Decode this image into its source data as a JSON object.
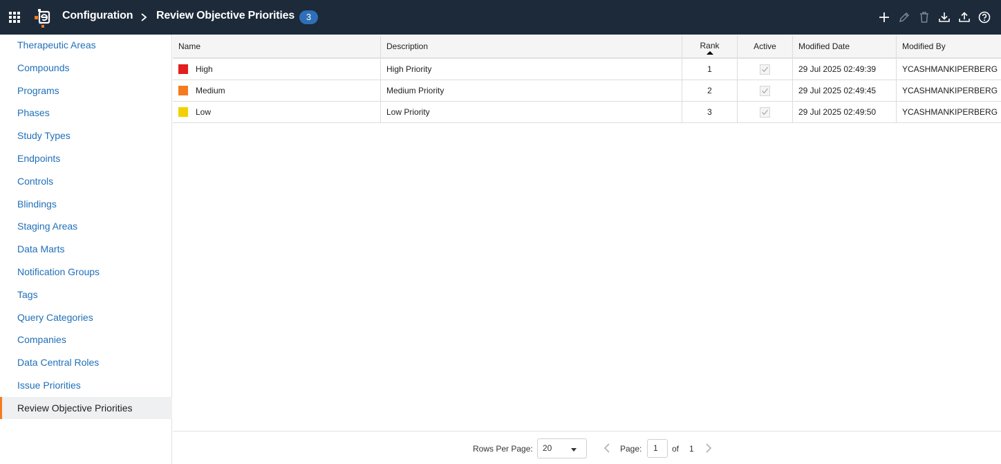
{
  "header": {
    "breadcrumb_root": "Configuration",
    "breadcrumb_current": "Review Objective Priorities",
    "record_count": "3",
    "colors": {
      "bar": "#1c2a3a",
      "badge": "#2e6fb7"
    }
  },
  "toolbar": {
    "icons": [
      "add-icon",
      "edit-icon",
      "delete-icon",
      "download-icon",
      "upload-icon",
      "help-icon"
    ]
  },
  "sidebar": {
    "items": [
      {
        "label": "Therapeutic Areas"
      },
      {
        "label": "Compounds"
      },
      {
        "label": "Programs"
      },
      {
        "label": "Phases"
      },
      {
        "label": "Study Types"
      },
      {
        "label": "Endpoints"
      },
      {
        "label": "Controls"
      },
      {
        "label": "Blindings"
      },
      {
        "label": "Staging Areas"
      },
      {
        "label": "Data Marts"
      },
      {
        "label": "Notification Groups"
      },
      {
        "label": "Tags"
      },
      {
        "label": "Query Categories"
      },
      {
        "label": "Companies"
      },
      {
        "label": "Data Central Roles"
      },
      {
        "label": "Issue Priorities"
      },
      {
        "label": "Review Objective Priorities"
      }
    ],
    "active_index": 16,
    "colors": {
      "link": "#1f6fb8",
      "active_marker": "#f47b20"
    }
  },
  "grid": {
    "columns": {
      "name": "Name",
      "description": "Description",
      "rank": "Rank",
      "active": "Active",
      "modified_date": "Modified Date",
      "modified_by": "Modified By"
    },
    "sort": {
      "column": "rank",
      "direction": "ascending"
    },
    "rows": [
      {
        "color": "#e31e1e",
        "name": "High",
        "description": "High Priority",
        "rank": "1",
        "active": true,
        "modified_date": "29 Jul 2025 02:49:39",
        "modified_by": "YCASHMANKIPERBERG"
      },
      {
        "color": "#f47b20",
        "name": "Medium",
        "description": "Medium Priority",
        "rank": "2",
        "active": true,
        "modified_date": "29 Jul 2025 02:49:45",
        "modified_by": "YCASHMANKIPERBERG"
      },
      {
        "color": "#f5d000",
        "name": "Low",
        "description": "Low Priority",
        "rank": "3",
        "active": true,
        "modified_date": "29 Jul 2025 02:49:50",
        "modified_by": "YCASHMANKIPERBERG"
      }
    ]
  },
  "pagination": {
    "rows_per_page_label": "Rows Per Page:",
    "rows_per_page": "20",
    "page_label": "Page:",
    "page": "1",
    "of_label": "of",
    "total_pages": "1"
  }
}
